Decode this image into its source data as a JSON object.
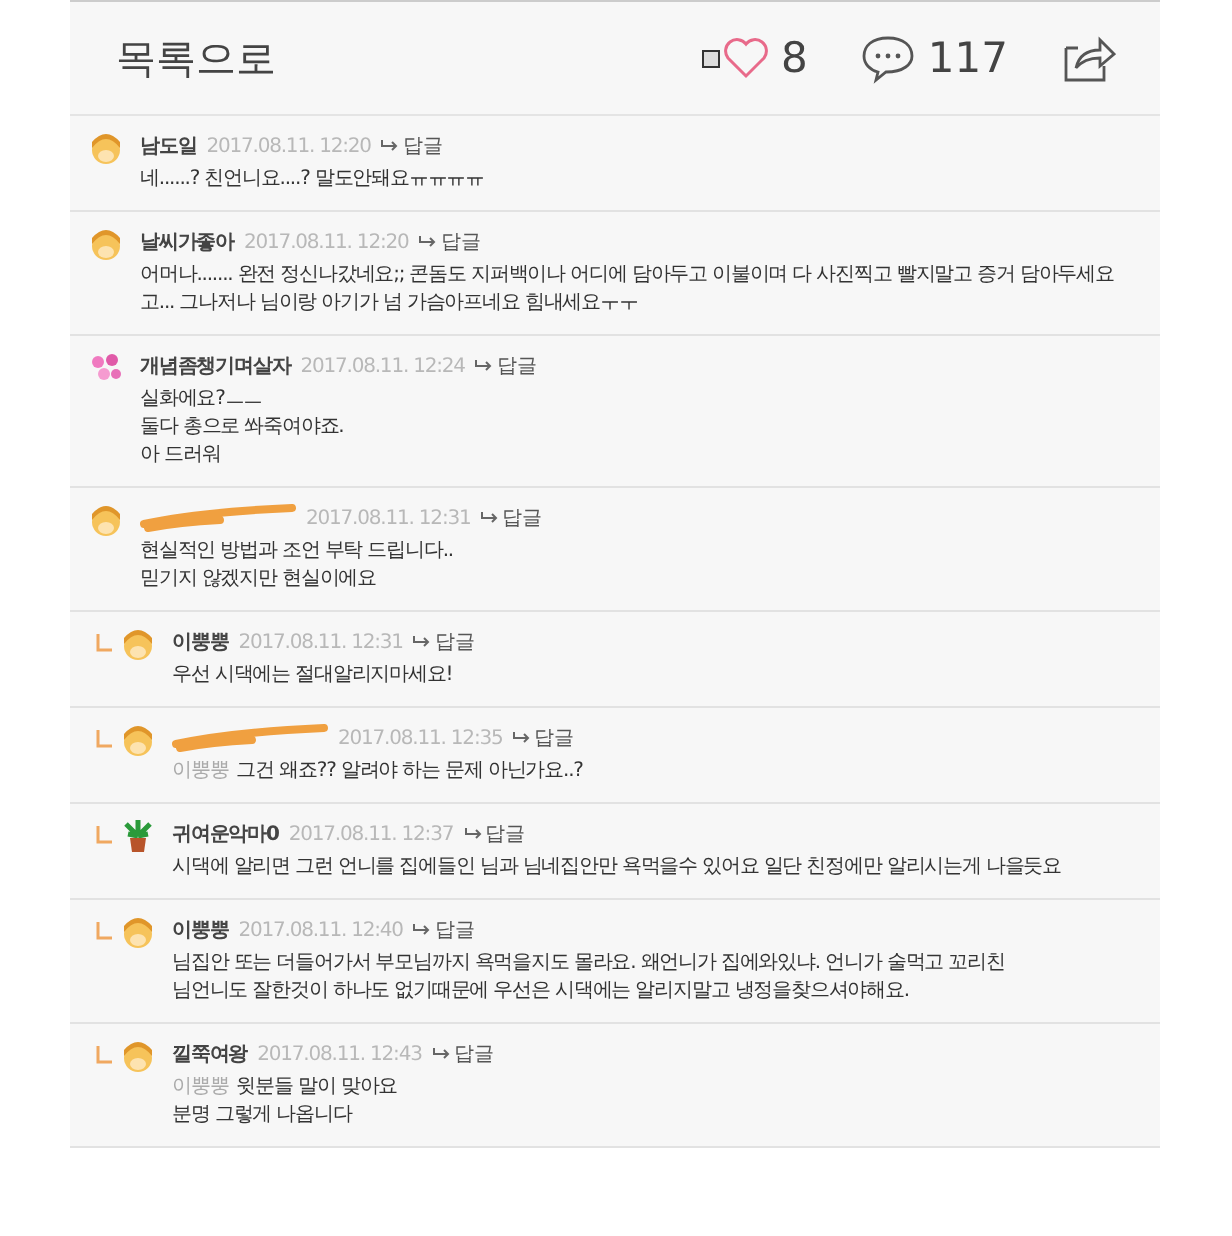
{
  "header": {
    "back_label": "목록으로",
    "likes": "8",
    "liked": false,
    "comment_count": "117"
  },
  "comments": [
    {
      "author": "남도일",
      "redacted": false,
      "kind": "blonde",
      "date": "2017.08.11. 12:20",
      "reply_label": "답글",
      "lines": [
        "네......? 친언니요....? 말도안돼요ㅠㅠㅠㅠ"
      ]
    },
    {
      "author": "날씨가좋아",
      "redacted": false,
      "kind": "blonde",
      "date": "2017.08.11. 12:20",
      "reply_label": "답글",
      "lines": [
        "어머나....... 완전 정신나갔네요;; 콘돔도 지퍼백이나 어디에 담아두고 이불이며 다 사진찍고 빨지말고 증거 담아두세요",
        "고... 그나저나 님이랑 아기가 넘 가슴아프네요 힘내세요ㅜㅜ"
      ]
    },
    {
      "author": "개념좀챙기며살자",
      "redacted": false,
      "kind": "flowers",
      "date": "2017.08.11. 12:24",
      "reply_label": "답글",
      "lines": [
        "실화에요?ㅡㅡ",
        "둘다 총으로 쏴죽여야죠.",
        "아 드러워"
      ]
    },
    {
      "redacted": true,
      "kind": "blonde",
      "date": "2017.08.11. 12:31",
      "reply_label": "답글",
      "lines": [
        "현실적인 방법과 조언 부탁 드립니다..",
        "믿기지 않겠지만 현실이에요"
      ],
      "children": [
        {
          "author": "이뿡뿡",
          "redacted": false,
          "kind": "blonde",
          "date": "2017.08.11. 12:31",
          "reply_label": "답글",
          "lines": [
            "우선 시댁에는 절대알리지마세요!"
          ]
        },
        {
          "redacted": true,
          "kind": "blonde",
          "date": "2017.08.11. 12:35",
          "reply_label": "답글",
          "mention": "이뿡뿡",
          "lines": [
            "그건 왜죠?? 알려야 하는 문제 아닌가요..?"
          ]
        },
        {
          "author": "귀여운악마0",
          "redacted": false,
          "kind": "plant",
          "date": "2017.08.11. 12:37",
          "reply_label": "답글",
          "lines": [
            "시댁에 알리면 그런 언니를 집에들인 님과 님네집안만 욕먹을수 있어요 일단 친정에만 알리시는게 나을듯요"
          ]
        },
        {
          "author": "이뿡뿡",
          "redacted": false,
          "kind": "blonde",
          "date": "2017.08.11. 12:40",
          "reply_label": "답글",
          "lines": [
            "님집안 또는 더들어가서 부모님까지 욕먹을지도 몰라요. 왜언니가 집에와있냐. 언니가 술먹고 꼬리친",
            "님언니도 잘한것이 하나도 없기때문에 우선은 시댁에는 알리지말고 냉정을찾으셔야해요."
          ]
        },
        {
          "author": "낄쭉여왕",
          "redacted": false,
          "kind": "blonde",
          "date": "2017.08.11. 12:43",
          "reply_label": "답글",
          "mention": "이뿡뿡",
          "lines": [
            "윗분들 말이 맞아요",
            "분명 그렇게 나옵니다"
          ]
        }
      ]
    }
  ]
}
